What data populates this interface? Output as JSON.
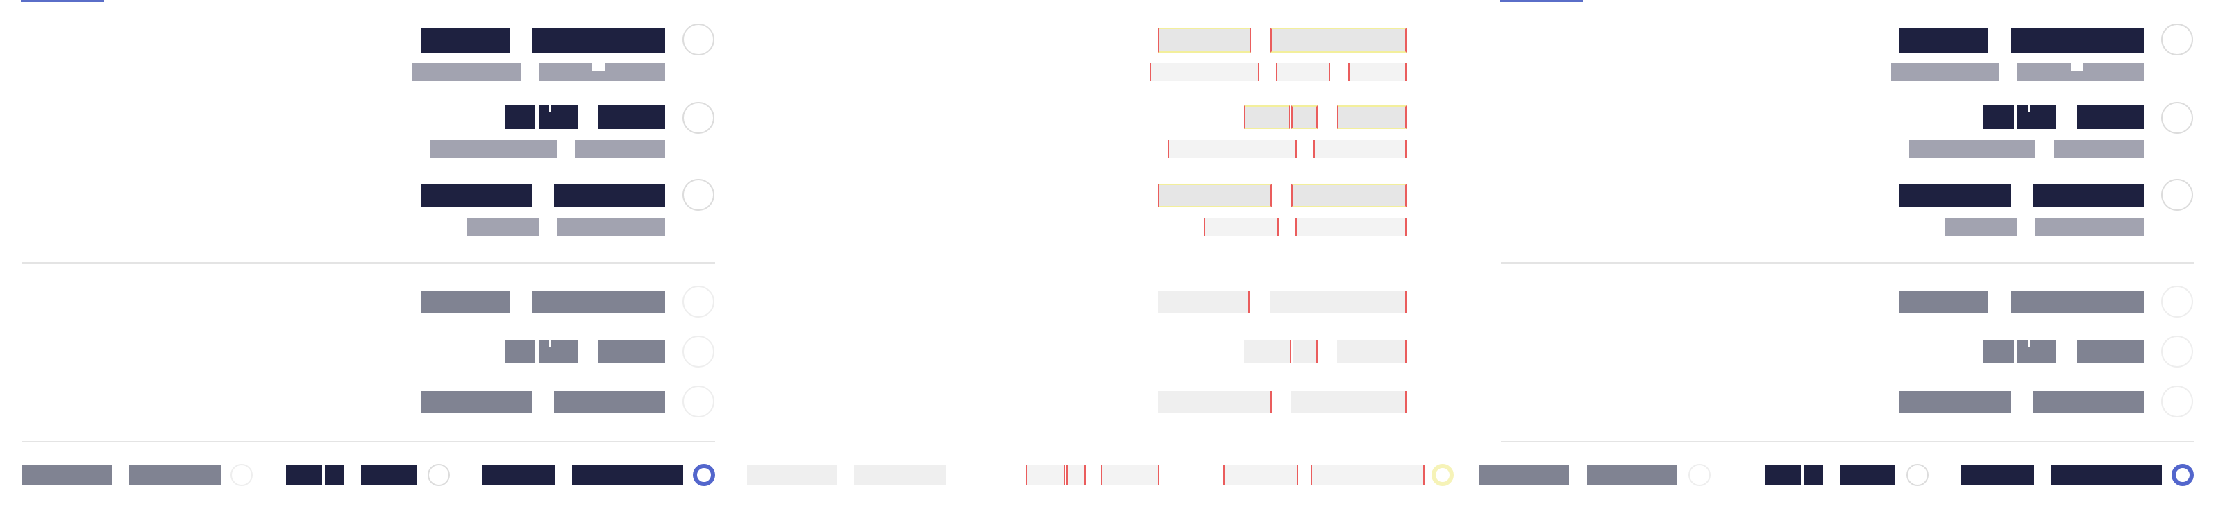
{
  "panels": [
    {
      "id": "panel-a",
      "state": "normal"
    },
    {
      "id": "panel-b",
      "state": "ghost"
    },
    {
      "id": "panel-c",
      "state": "normal"
    }
  ],
  "options_group_1": [
    {
      "selected": false
    },
    {
      "selected": false
    },
    {
      "selected": false
    }
  ],
  "options_group_2": [
    {
      "selected": false
    },
    {
      "selected": false
    },
    {
      "selected": false
    }
  ],
  "bottom_bar": {
    "options": [
      {
        "selected": false
      },
      {
        "selected": false
      },
      {
        "selected": true
      }
    ]
  },
  "colors": {
    "primary_text": "#1e2140",
    "secondary_text": "#a2a3b0",
    "muted_text": "#808392",
    "accent": "#5366cc",
    "divider": "#e4e4e4",
    "ghost_outline": "#ea5d5d",
    "ghost_highlight": "#f3ef9c"
  },
  "icons": {
    "radio": "radio-button-icon",
    "radio_selected": "radio-button-selected-icon"
  }
}
